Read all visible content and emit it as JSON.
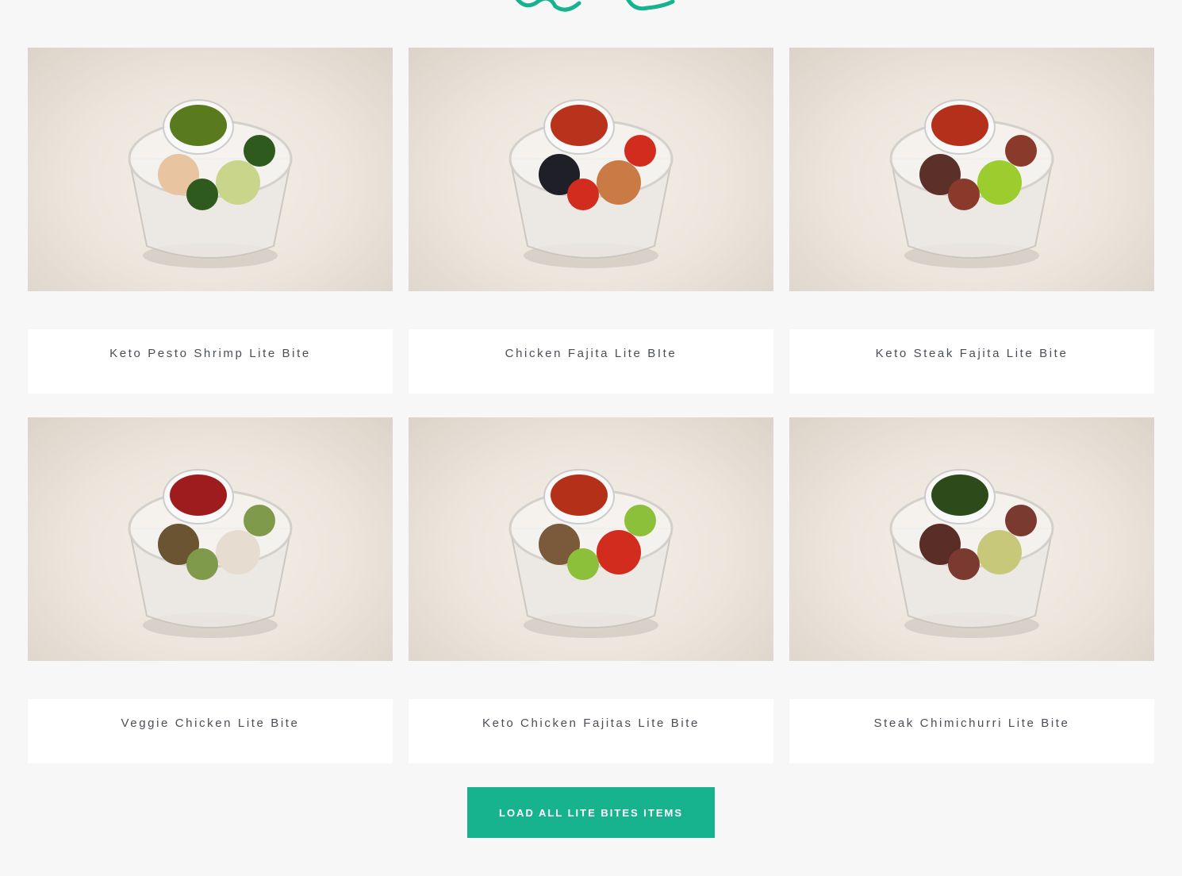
{
  "colors": {
    "accent": "#16b38e",
    "page_bg": "#f7f7f7",
    "card_bg": "#ffffff",
    "label_text": "#4a4f55"
  },
  "ornament": {
    "icon": "teal-wave-ornament-icon"
  },
  "products": [
    {
      "name": "Keto Pesto Shrimp Lite Bite",
      "sauce": "#5a7a1e",
      "food": [
        "#e9c4a0",
        "#c9d58a",
        "#2e5a1e"
      ]
    },
    {
      "name": "Chicken Fajita Lite BIte",
      "sauce": "#b8321c",
      "food": [
        "#1f1f28",
        "#c97a45",
        "#d12c1e"
      ]
    },
    {
      "name": "Keto Steak Fajita Lite Bite",
      "sauce": "#b5301b",
      "food": [
        "#5a3028",
        "#9ccc2e",
        "#8a3a2a"
      ]
    },
    {
      "name": "Veggie Chicken Lite Bite",
      "sauce": "#9e1c1e",
      "food": [
        "#6a5432",
        "#e6ddd0",
        "#7e9a4a"
      ]
    },
    {
      "name": "Keto Chicken Fajitas Lite Bite",
      "sauce": "#b53019",
      "food": [
        "#7a5a3a",
        "#d12c1e",
        "#8cbf3a"
      ]
    },
    {
      "name": "Steak Chimichurri Lite Bite",
      "sauce": "#2c4a1a",
      "food": [
        "#5a2e26",
        "#c8c87a",
        "#7a3a30"
      ]
    }
  ],
  "load_button": {
    "label": "LOAD ALL LITE BITES ITEMS"
  }
}
